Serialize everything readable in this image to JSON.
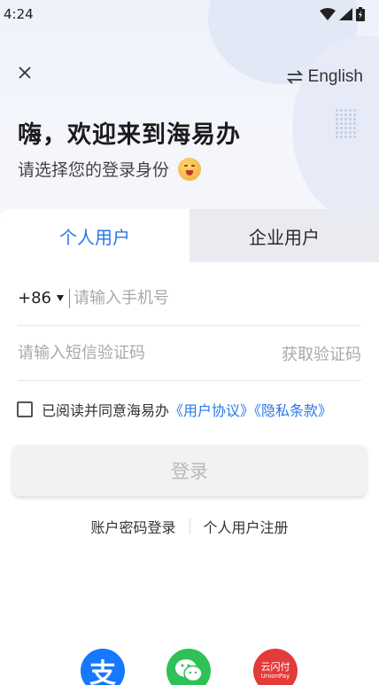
{
  "status_bar": {
    "time": "4:24",
    "icons": [
      "wifi-icon",
      "signal-icon",
      "battery-icon"
    ]
  },
  "header": {
    "language_label": "English",
    "close_icon": "close-icon",
    "swap_icon": "swap-icon"
  },
  "greeting": {
    "title": "嗨，欢迎来到海易办",
    "subtitle": "请选择您的登录身份"
  },
  "tabs": [
    {
      "label": "个人用户",
      "active": true
    },
    {
      "label": "企业用户",
      "active": false
    }
  ],
  "form": {
    "country_code": "+86",
    "phone_placeholder": "请输入手机号",
    "sms_placeholder": "请输入短信验证码",
    "get_code_label": "获取验证码"
  },
  "agreement": {
    "text": "已阅读并同意海易办",
    "user_agreement": "《用户协议》",
    "privacy_policy": "《隐私条款》",
    "checked": false
  },
  "login_button": "登录",
  "alt_links": {
    "password_login": "账户密码登录",
    "register": "个人用户注册"
  },
  "social_logins": {
    "alipay_glyph": "支",
    "unionpay_label": "云闪付",
    "unionpay_sub": "UnionPay"
  },
  "colors": {
    "accent": "#2a76e8",
    "tab_inactive_bg": "#e9ebf1",
    "hero_bg": "#eef2fb"
  }
}
